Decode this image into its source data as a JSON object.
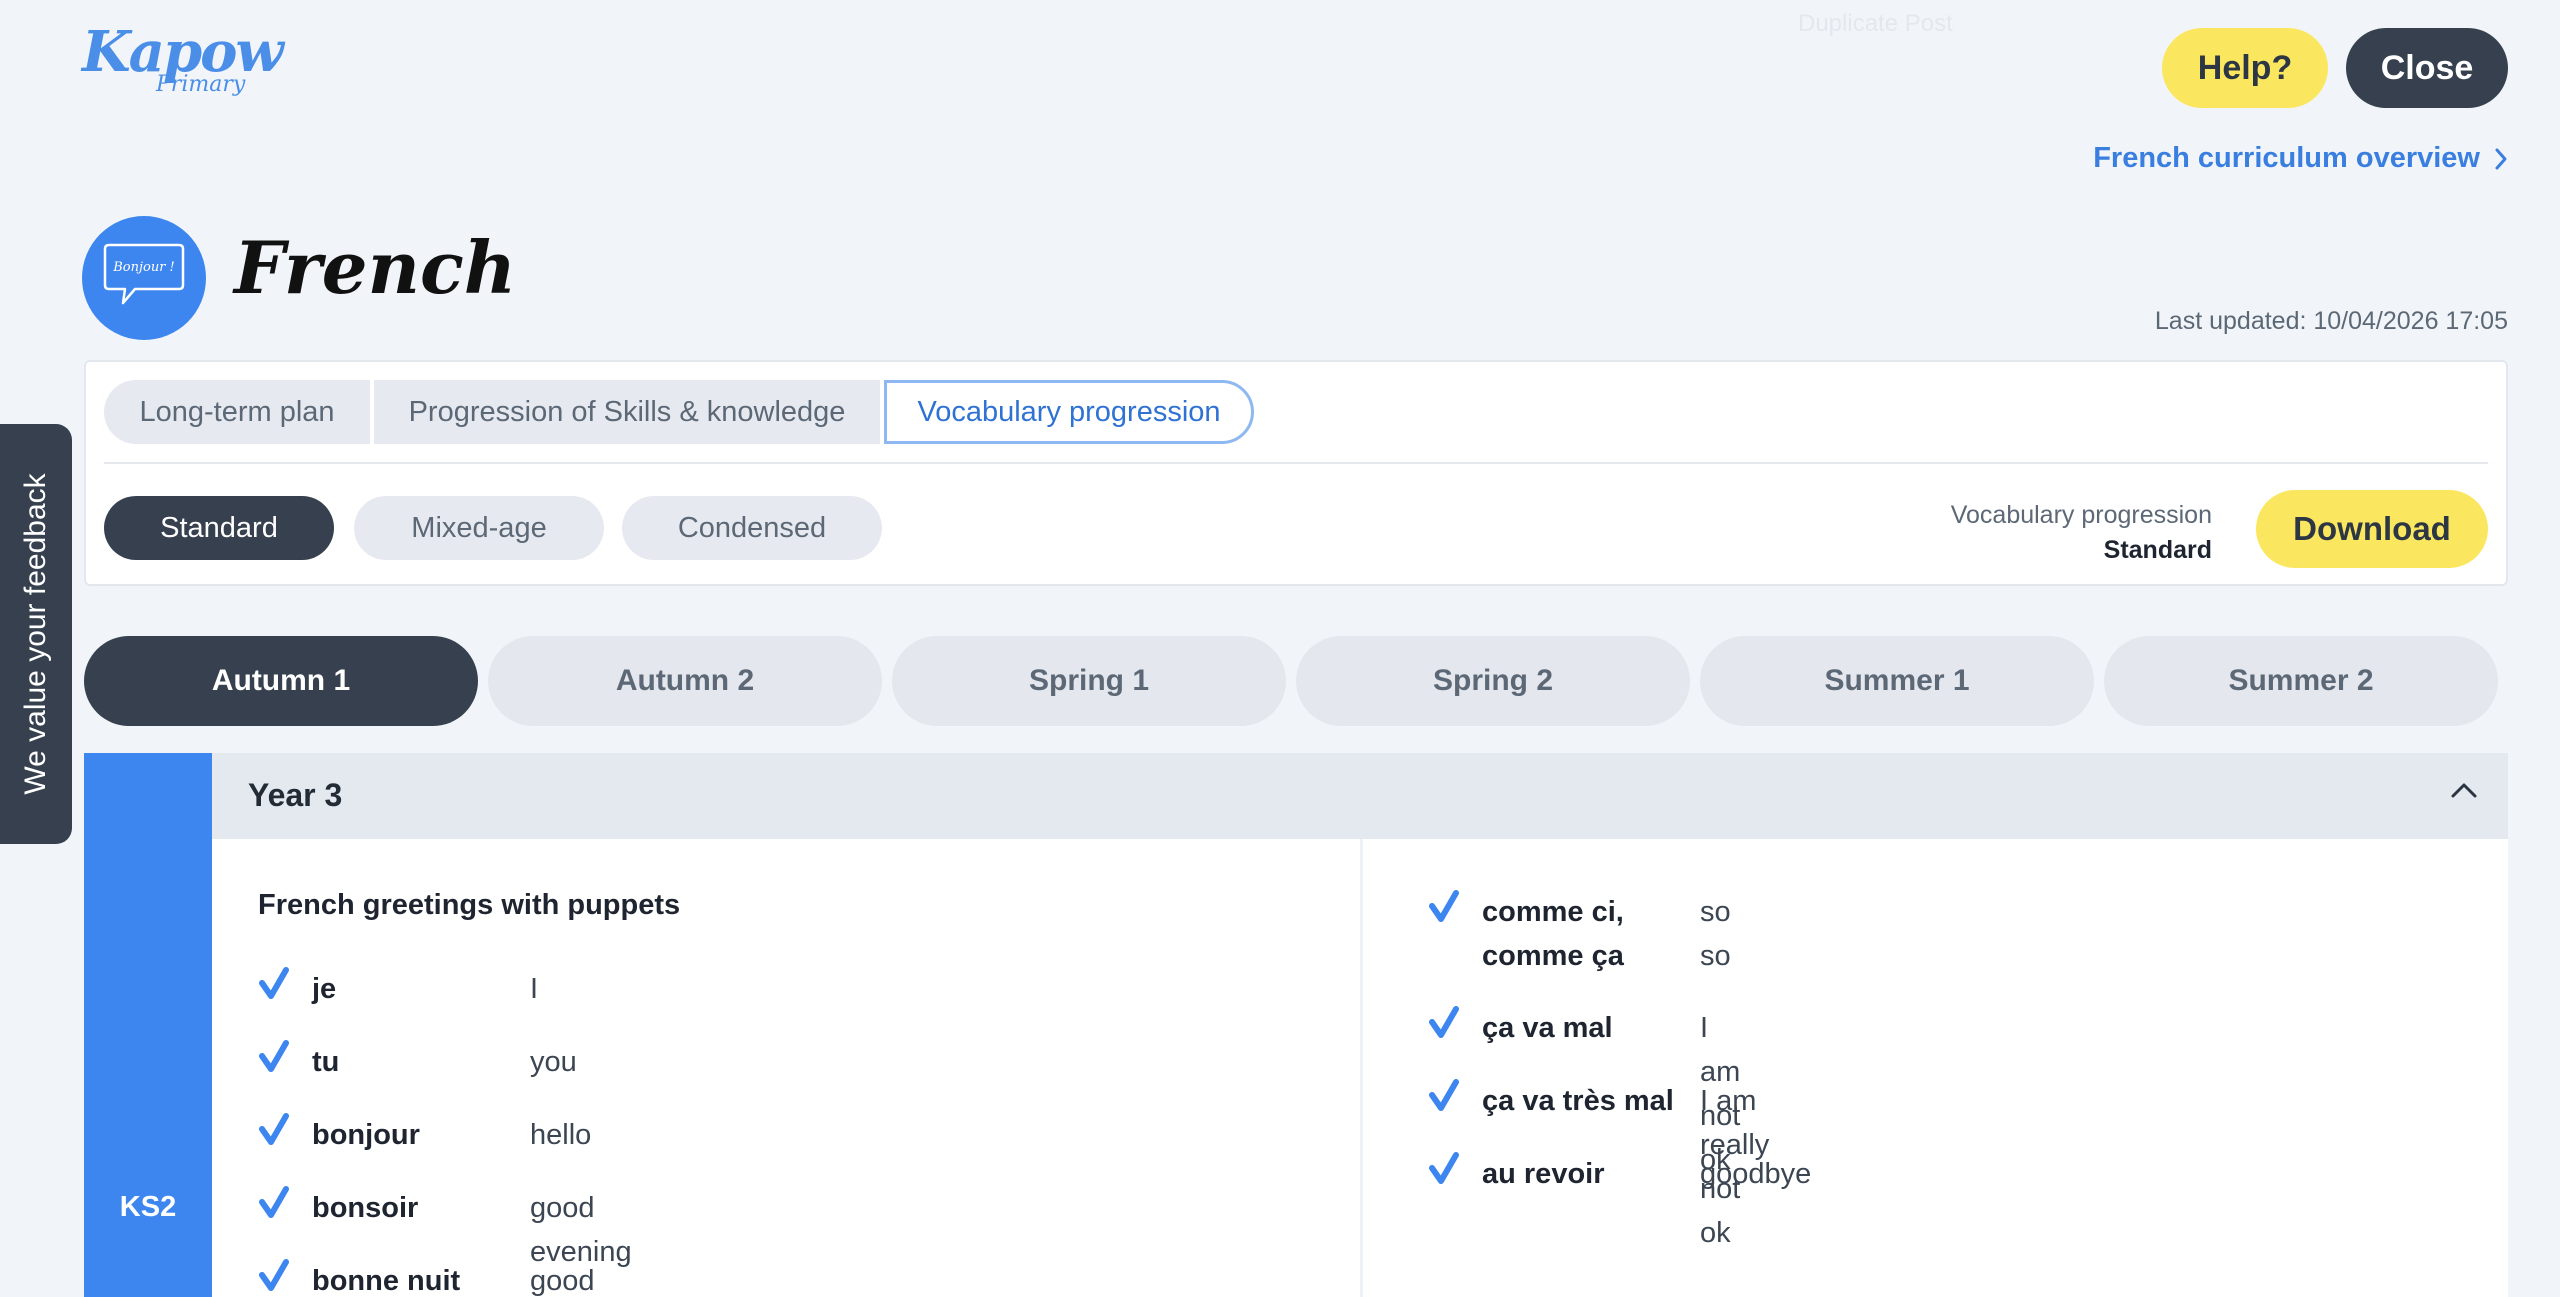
{
  "header": {
    "logo_main": "Kapow",
    "logo_sub": "Primary",
    "ghost_text": "Duplicate Post",
    "help_label": "Help?",
    "close_label": "Close",
    "overview_link": "French curriculum overview",
    "subject_title": "French",
    "subject_icon_text": "Bonjour !",
    "last_updated": "Last updated: 10/04/2026 17:05"
  },
  "tabs": [
    {
      "label": "Long-term plan"
    },
    {
      "label": "Progression of Skills & knowledge"
    },
    {
      "label": "Vocabulary progression",
      "active": true
    }
  ],
  "versions": [
    {
      "label": "Standard",
      "active": true
    },
    {
      "label": "Mixed-age"
    },
    {
      "label": "Condensed"
    }
  ],
  "download": {
    "caption": "Vocabulary progression",
    "version": "Standard",
    "button": "Download"
  },
  "terms": [
    {
      "label": "Autumn 1",
      "active": true
    },
    {
      "label": "Autumn 2"
    },
    {
      "label": "Spring 1"
    },
    {
      "label": "Spring 2"
    },
    {
      "label": "Summer 1"
    },
    {
      "label": "Summer 2"
    }
  ],
  "content": {
    "key_stage": "KS2",
    "year": "Year 3",
    "unit_title": "French greetings with puppets",
    "left_vocab": [
      {
        "fr": "je",
        "en": "I"
      },
      {
        "fr": "tu",
        "en": "you"
      },
      {
        "fr": "bonjour",
        "en": "hello"
      },
      {
        "fr": "bonsoir",
        "en": "good evening"
      },
      {
        "fr": "bonne nuit",
        "en": "good night"
      }
    ],
    "right_vocab": [
      {
        "fr1": "comme ci,",
        "fr2": "comme ça",
        "en": "so so"
      },
      {
        "fr": "ça va mal",
        "en": "I am not ok"
      },
      {
        "fr": "ça va très mal",
        "en": "I am really not ok"
      },
      {
        "fr": "au revoir",
        "en": "goodbye"
      }
    ]
  },
  "feedback_label": "We value your feedback",
  "colors": {
    "background": "#f1f5f9",
    "brand_blue": "#3d86ef",
    "dark": "#36404e",
    "yellow": "#fbe75f",
    "link_blue": "#3a7fe0"
  }
}
